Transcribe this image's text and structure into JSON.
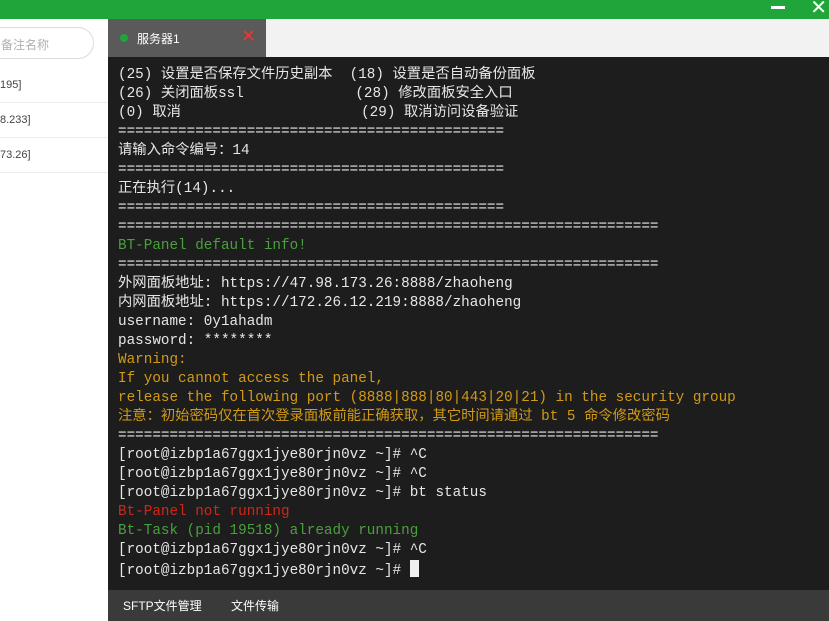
{
  "colors": {
    "accent": "#20a53a",
    "terminal_bg": "#1d1d1d",
    "terminal_text": "#e6e6e6",
    "terminal_green": "#49a03c",
    "terminal_yellow": "#d19a16",
    "terminal_red": "#d0261c",
    "tab_bg": "#5a5a5a",
    "tab_close": "#e53935"
  },
  "window": {
    "minimize_icon": "minimize-icon",
    "close_icon": "close-icon",
    "close_glyph": "✕"
  },
  "sidebar": {
    "search_placeholder": "备注名称",
    "servers": [
      {
        "label": "195]"
      },
      {
        "label": "8.233]"
      },
      {
        "label": "73.26]"
      }
    ]
  },
  "tabs": [
    {
      "label": "服务器1",
      "status_icon": "online-dot-icon",
      "close_glyph": "✕"
    }
  ],
  "terminal": {
    "lines": [
      {
        "text": "(25) 设置是否保存文件历史副本  (18) 设置是否自动备份面板",
        "style": "white"
      },
      {
        "text": "(26) 关闭面板ssl             (28) 修改面板安全入口",
        "style": "white"
      },
      {
        "text": "(0) 取消                     (29) 取消访问设备验证",
        "style": "white"
      },
      {
        "text": "=============================================",
        "style": "white"
      },
      {
        "text": "请输入命令编号：14",
        "style": "white"
      },
      {
        "text": "=============================================",
        "style": "white"
      },
      {
        "text": "正在执行(14)...",
        "style": "white"
      },
      {
        "text": "=============================================",
        "style": "white"
      },
      {
        "text": "===============================================================",
        "style": "white"
      },
      {
        "text": "BT-Panel default info!",
        "style": "green"
      },
      {
        "text": "===============================================================",
        "style": "white"
      },
      {
        "text": "外网面板地址: https://47.98.173.26:8888/zhaoheng",
        "style": "white"
      },
      {
        "text": "内网面板地址: https://172.26.12.219:8888/zhaoheng",
        "style": "white"
      },
      {
        "text": "username: 0y1ahadm",
        "style": "white"
      },
      {
        "text": "password: ********",
        "style": "white"
      },
      {
        "text": "Warning:",
        "style": "yellow"
      },
      {
        "text": "If you cannot access the panel,",
        "style": "yellow"
      },
      {
        "text": "release the following port (8888|888|80|443|20|21) in the security group",
        "style": "yellow"
      },
      {
        "text": "注意：初始密码仅在首次登录面板前能正确获取，其它时间请通过 bt 5 命令修改密码",
        "style": "yellow"
      },
      {
        "text": "===============================================================",
        "style": "white"
      },
      {
        "text": "[root@izbp1a67ggx1jye80rjn0vz ~]# ^C",
        "style": "white"
      },
      {
        "text": "[root@izbp1a67ggx1jye80rjn0vz ~]# ^C",
        "style": "white"
      },
      {
        "text": "[root@izbp1a67ggx1jye80rjn0vz ~]# bt status",
        "style": "white"
      },
      {
        "text": "Bt-Panel not running",
        "style": "red"
      },
      {
        "text": "Bt-Task (pid 19518) already running",
        "style": "green"
      },
      {
        "text": "[root@izbp1a67ggx1jye80rjn0vz ~]# ^C",
        "style": "white"
      },
      {
        "text": "[root@izbp1a67ggx1jye80rjn0vz ~]# ",
        "style": "white",
        "cursor": true
      }
    ]
  },
  "bottombar": {
    "sftp_label": "SFTP文件管理",
    "transfer_label": "文件传输"
  }
}
